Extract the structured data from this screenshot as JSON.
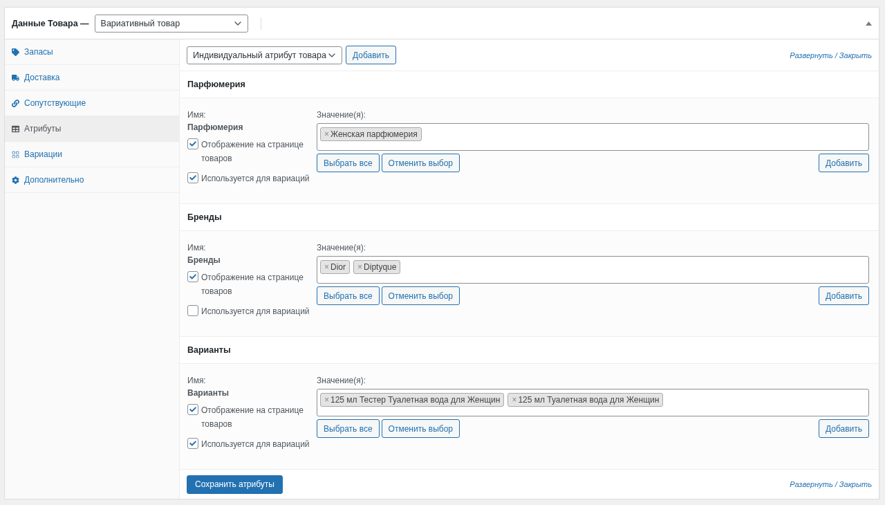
{
  "header": {
    "title": "Данные Товара —",
    "product_type": "Вариативный товар"
  },
  "sidebar": {
    "items": [
      {
        "label": "Запасы",
        "selected": false
      },
      {
        "label": "Доставка",
        "selected": false
      },
      {
        "label": "Сопутствующие",
        "selected": false
      },
      {
        "label": "Атрибуты",
        "selected": true
      },
      {
        "label": "Вариации",
        "selected": false
      },
      {
        "label": "Дополнительно",
        "selected": false
      }
    ]
  },
  "toolbar": {
    "attribute_select": "Индивидуальный атрибут товара",
    "add_button": "Добавить",
    "expand": "Развернуть",
    "separator": "/",
    "collapse": "Закрыть"
  },
  "attributes": [
    {
      "title": "Парфюмерия",
      "name_label": "Имя:",
      "name": "Парфюмерия",
      "values_label": "Значение(я):",
      "tags": [
        {
          "remove": "×",
          "label": "Женская парфюмерия"
        }
      ],
      "visible_label": "Отображение на странице товаров",
      "visible": true,
      "variation_label": "Используется для вариаций",
      "variation": true,
      "select_all": "Выбрать все",
      "select_none": "Отменить выбор",
      "add": "Добавить"
    },
    {
      "title": "Бренды",
      "name_label": "Имя:",
      "name": "Бренды",
      "values_label": "Значение(я):",
      "tags": [
        {
          "remove": "×",
          "label": "Dior"
        },
        {
          "remove": "×",
          "label": "Diptyque"
        }
      ],
      "visible_label": "Отображение на странице товаров",
      "visible": true,
      "variation_label": "Используется для вариаций",
      "variation": false,
      "select_all": "Выбрать все",
      "select_none": "Отменить выбор",
      "add": "Добавить"
    },
    {
      "title": "Варианты",
      "name_label": "Имя:",
      "name": "Варианты",
      "values_label": "Значение(я):",
      "tags": [
        {
          "remove": "×",
          "label": "125 мл Тестер Туалетная вода для Женщин"
        },
        {
          "remove": "×",
          "label": "125 мл Туалетная вода для Женщин"
        }
      ],
      "visible_label": "Отображение на странице товаров",
      "visible": true,
      "variation_label": "Используется для вариаций",
      "variation": true,
      "select_all": "Выбрать все",
      "select_none": "Отменить выбор",
      "add": "Добавить"
    }
  ],
  "footer": {
    "save_button": "Сохранить атрибуты",
    "expand": "Развернуть",
    "separator": "/",
    "collapse": "Закрыть"
  }
}
